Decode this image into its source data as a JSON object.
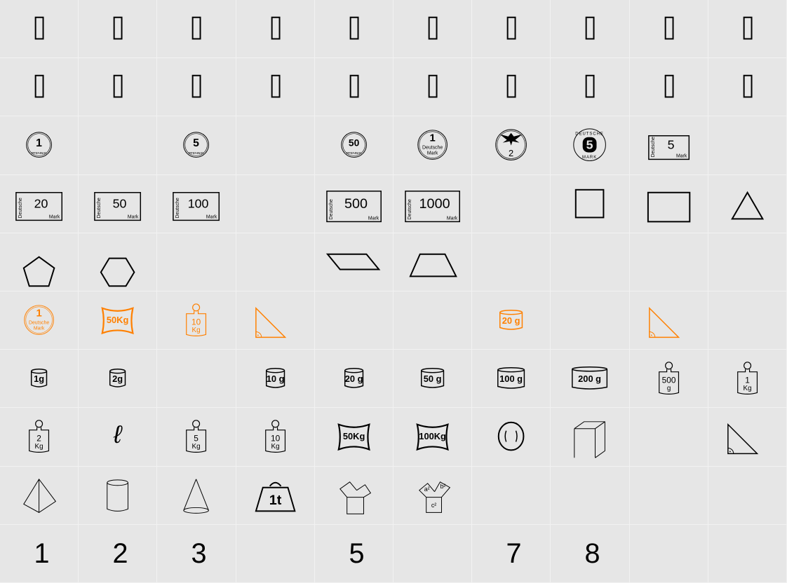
{
  "colors": {
    "ink": "#000000",
    "accent": "#ff8000",
    "background": "#e6e6e6",
    "grid_line": "#f2f2f2"
  },
  "coin_text": {
    "pfennig": "PFENNIG",
    "deutsche": "Deutsche",
    "mark": "Mark",
    "deutsche_caps": "DEUTSCHE",
    "mark_caps": "MARK"
  },
  "grid": [
    [
      {
        "type": "missing-glyph"
      },
      {
        "type": "missing-glyph"
      },
      {
        "type": "missing-glyph"
      },
      {
        "type": "missing-glyph"
      },
      {
        "type": "missing-glyph"
      },
      {
        "type": "missing-glyph"
      },
      {
        "type": "missing-glyph"
      },
      {
        "type": "missing-glyph"
      },
      {
        "type": "missing-glyph"
      },
      {
        "type": "missing-glyph"
      }
    ],
    [
      {
        "type": "missing-glyph"
      },
      {
        "type": "missing-glyph"
      },
      {
        "type": "missing-glyph"
      },
      {
        "type": "missing-glyph"
      },
      {
        "type": "missing-glyph"
      },
      {
        "type": "missing-glyph"
      },
      {
        "type": "missing-glyph"
      },
      {
        "type": "missing-glyph"
      },
      {
        "type": "missing-glyph"
      },
      {
        "type": "missing-glyph"
      }
    ],
    [
      {
        "type": "coin-pfennig",
        "value": "1"
      },
      {
        "type": "empty"
      },
      {
        "type": "coin-pfennig",
        "value": "5"
      },
      {
        "type": "empty"
      },
      {
        "type": "coin-pfennig",
        "value": "50"
      },
      {
        "type": "coin-mark",
        "value": "1"
      },
      {
        "type": "coin-eagle",
        "value": "2"
      },
      {
        "type": "coin-mark-ring",
        "value": "5"
      },
      {
        "type": "banknote",
        "value": "5",
        "size": "small"
      },
      {
        "type": "empty"
      }
    ],
    [
      {
        "type": "banknote",
        "value": "20"
      },
      {
        "type": "banknote",
        "value": "50"
      },
      {
        "type": "banknote",
        "value": "100"
      },
      {
        "type": "empty"
      },
      {
        "type": "banknote",
        "value": "500",
        "size": "large"
      },
      {
        "type": "banknote",
        "value": "1000",
        "size": "large"
      },
      {
        "type": "empty"
      },
      {
        "type": "square"
      },
      {
        "type": "rectangle"
      },
      {
        "type": "triangle"
      }
    ],
    [
      {
        "type": "pentagon"
      },
      {
        "type": "hexagon"
      },
      {
        "type": "empty"
      },
      {
        "type": "empty"
      },
      {
        "type": "parallelogram"
      },
      {
        "type": "trapezoid"
      },
      {
        "type": "empty"
      },
      {
        "type": "empty"
      },
      {
        "type": "empty"
      },
      {
        "type": "empty"
      }
    ],
    [
      {
        "type": "coin-mark",
        "value": "1",
        "color": "accent"
      },
      {
        "type": "sack",
        "value": "50Kg",
        "color": "accent"
      },
      {
        "type": "knob-weight",
        "value": "10",
        "unit": "Kg",
        "color": "accent"
      },
      {
        "type": "right-triangle",
        "color": "accent"
      },
      {
        "type": "empty"
      },
      {
        "type": "empty"
      },
      {
        "type": "cylinder-weight",
        "value": "20 g",
        "size": 2,
        "color": "accent"
      },
      {
        "type": "empty"
      },
      {
        "type": "right-triangle",
        "color": "accent"
      },
      {
        "type": "empty"
      }
    ],
    [
      {
        "type": "cylinder-weight",
        "value": "1g",
        "size": 0
      },
      {
        "type": "cylinder-weight",
        "value": "2g",
        "size": 0
      },
      {
        "type": "empty"
      },
      {
        "type": "cylinder-weight",
        "value": "10 g",
        "size": 1
      },
      {
        "type": "cylinder-weight",
        "value": "20 g",
        "size": 1
      },
      {
        "type": "cylinder-weight",
        "value": "50 g",
        "size": 2
      },
      {
        "type": "cylinder-weight",
        "value": "100 g",
        "size": 3
      },
      {
        "type": "cylinder-weight",
        "value": "200 g",
        "size": 4
      },
      {
        "type": "knob-weight",
        "value": "500",
        "unit": "g"
      },
      {
        "type": "knob-weight",
        "value": "1",
        "unit": "Kg"
      }
    ],
    [
      {
        "type": "knob-weight",
        "value": "2",
        "unit": "Kg"
      },
      {
        "type": "script-l",
        "value": "ℓ"
      },
      {
        "type": "knob-weight",
        "value": "5",
        "unit": "Kg"
      },
      {
        "type": "knob-weight",
        "value": "10",
        "unit": "Kg"
      },
      {
        "type": "sack",
        "value": "50Kg"
      },
      {
        "type": "sack",
        "value": "100Kg"
      },
      {
        "type": "lens"
      },
      {
        "type": "cuboid"
      },
      {
        "type": "empty"
      },
      {
        "type": "right-triangle"
      }
    ],
    [
      {
        "type": "pyramid"
      },
      {
        "type": "cylinder"
      },
      {
        "type": "cone"
      },
      {
        "type": "ton-weight",
        "value": "1t"
      },
      {
        "type": "pythagoras"
      },
      {
        "type": "pythagoras-labeled",
        "labels": [
          "a²",
          "b²",
          "c²"
        ]
      },
      {
        "type": "empty"
      },
      {
        "type": "empty"
      },
      {
        "type": "empty"
      },
      {
        "type": "empty"
      }
    ],
    [
      {
        "type": "digit",
        "value": "1"
      },
      {
        "type": "digit",
        "value": "2"
      },
      {
        "type": "digit",
        "value": "3"
      },
      {
        "type": "empty"
      },
      {
        "type": "digit",
        "value": "5"
      },
      {
        "type": "empty"
      },
      {
        "type": "digit",
        "value": "7"
      },
      {
        "type": "digit",
        "value": "8"
      },
      {
        "type": "empty"
      },
      {
        "type": "empty"
      }
    ]
  ]
}
